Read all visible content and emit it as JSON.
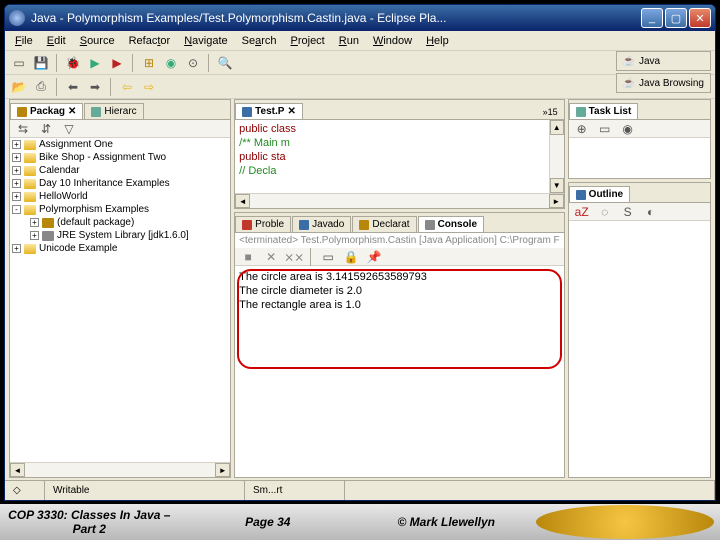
{
  "titlebar": {
    "title": "Java - Polymorphism Examples/Test.Polymorphism.Castin.java - Eclipse Pla..."
  },
  "menubar": [
    "File",
    "Edit",
    "Source",
    "Refactor",
    "Navigate",
    "Search",
    "Project",
    "Run",
    "Window",
    "Help"
  ],
  "perspectives": {
    "java": "Java",
    "browsing": "Java Browsing"
  },
  "left_panel": {
    "tabs": [
      "Packag",
      "Hierarc"
    ],
    "tree": [
      {
        "exp": "+",
        "label": "Assignment One"
      },
      {
        "exp": "+",
        "label": "Bike Shop - Assignment Two"
      },
      {
        "exp": "+",
        "label": "Calendar"
      },
      {
        "exp": "+",
        "label": "Day 10 Inheritance Examples"
      },
      {
        "exp": "+",
        "label": "HelloWorld"
      },
      {
        "exp": "-",
        "label": "Polymorphism Examples"
      },
      {
        "exp": "+",
        "label": "(default package)",
        "child": true,
        "pkg": true
      },
      {
        "exp": "+",
        "label": "JRE System Library [jdk1.6.0]",
        "child": true,
        "lib": true
      },
      {
        "exp": "+",
        "label": "Unicode Example"
      }
    ]
  },
  "editor": {
    "tab": "Test.P",
    "overflow": "»15",
    "lines": [
      {
        "cls": "kw",
        "text": "public class"
      },
      {
        "cls": "cm",
        "text": "/** Main m"
      },
      {
        "cls": "kw",
        "text": "public sta"
      },
      {
        "cls": "cm",
        "text": "// Decla"
      }
    ]
  },
  "bottom_tabs": [
    "Proble",
    "Javado",
    "Declarat",
    "Console"
  ],
  "console": {
    "header": "<terminated> Test.Polymorphism.Castin [Java Application] C:\\Program F",
    "lines": [
      "The circle area is 3.141592653589793",
      "The circle diameter is 2.0",
      "The rectangle area is 1.0"
    ]
  },
  "right_panels": {
    "task": "Task List",
    "outline": "Outline"
  },
  "statusbar": {
    "writable": "Writable",
    "insert": "Sm...rt"
  },
  "footer": {
    "left": "COP 3330: Classes In Java – Part 2",
    "mid": "Page 34",
    "right": "© Mark Llewellyn"
  }
}
